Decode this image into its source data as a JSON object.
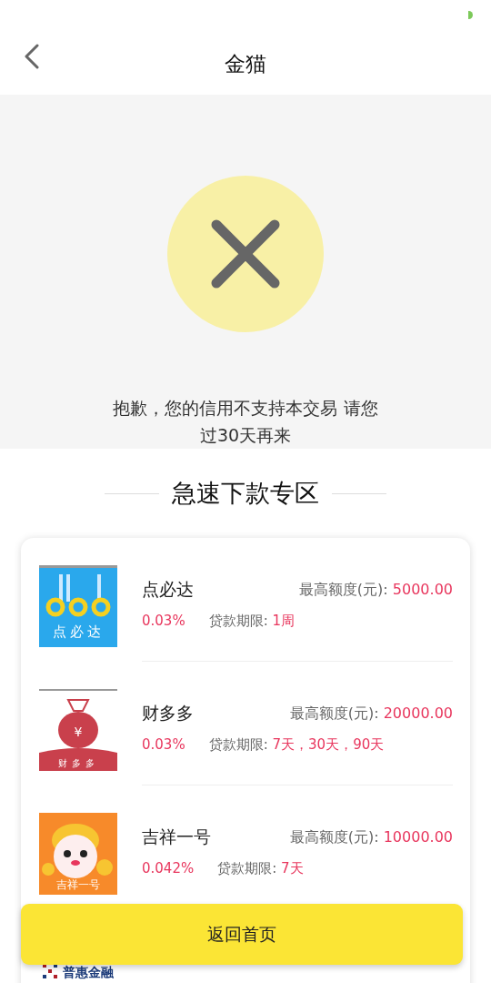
{
  "header": {
    "title": "金猫"
  },
  "result": {
    "message": "抱歉，您的信用不支持本交易 请您过30天再来"
  },
  "section": {
    "title": "急速下款专区"
  },
  "products": [
    {
      "kind": "dots",
      "logo_text": "点必达",
      "name": "点必达",
      "amount_label": "最高额度(元):",
      "amount": "5000.00",
      "rate": "0.03%",
      "term_label": "贷款期限:",
      "term": "1周"
    },
    {
      "kind": "bag",
      "logo_text": "财多多",
      "logo_mark": "¥",
      "name": "财多多",
      "amount_label": "最高额度(元):",
      "amount": "20000.00",
      "rate": "0.03%",
      "term_label": "贷款期限:",
      "term": "7天，30天，90天"
    },
    {
      "kind": "mascot",
      "logo_text": "吉祥一号",
      "name": "吉祥一号",
      "amount_label": "最高额度(元):",
      "amount": "10000.00",
      "rate": "0.042%",
      "term_label": "贷款期限:",
      "term": "7天"
    },
    {
      "kind": "grid",
      "logo_text": "普惠金融"
    }
  ],
  "home_button": "返回首页"
}
